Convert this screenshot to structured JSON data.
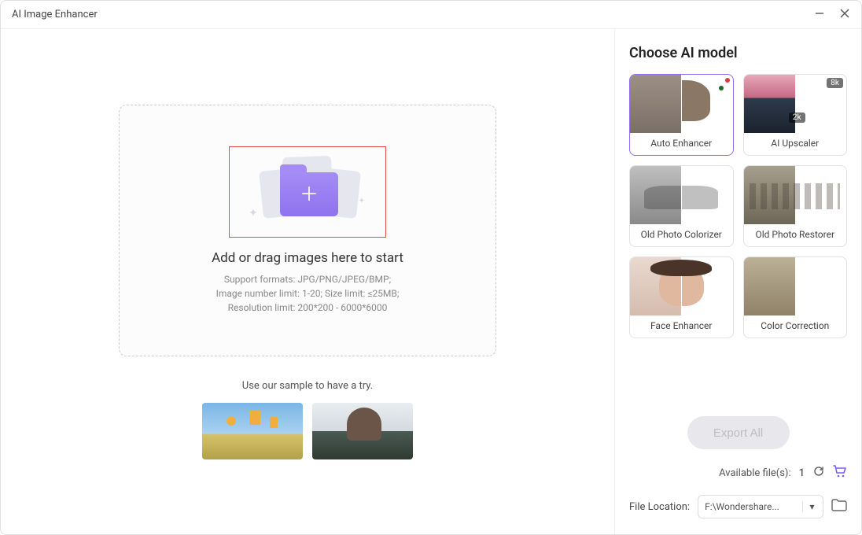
{
  "window": {
    "title": "AI Image Enhancer"
  },
  "dropzone": {
    "heading": "Add or drag images here to start",
    "line1": "Support formats: JPG/PNG/JPEG/BMP;",
    "line2": "Image number limit: 1-20; Size limit: ≤25MB;",
    "line3": "Resolution limit: 200*200 - 6000*6000"
  },
  "sample_label": "Use our sample to have a try.",
  "panel": {
    "title": "Choose AI model"
  },
  "models": {
    "auto": "Auto Enhancer",
    "upscaler": "AI Upscaler",
    "upscaler_tag1": "2k",
    "upscaler_tag2": "8k",
    "colorizer": "Old Photo Colorizer",
    "restorer": "Old Photo Restorer",
    "face": "Face Enhancer",
    "color": "Color Correction"
  },
  "export_label": "Export All",
  "available": {
    "label": "Available file(s):",
    "count": "1"
  },
  "location": {
    "label": "File Location:",
    "value": "F:\\Wondershare..."
  }
}
